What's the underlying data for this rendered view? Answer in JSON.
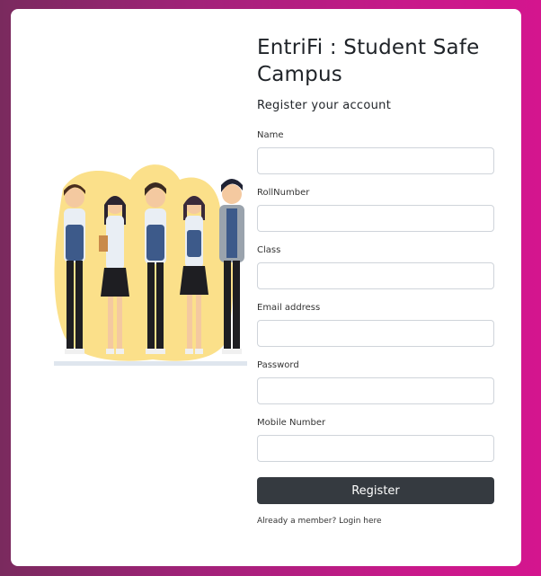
{
  "app": {
    "title": "EntriFi : Student Safe Campus",
    "subtitle": "Register your account"
  },
  "form": {
    "fields": [
      {
        "label": "Name",
        "value": ""
      },
      {
        "label": "RollNumber",
        "value": ""
      },
      {
        "label": "Class",
        "value": ""
      },
      {
        "label": "Email address",
        "value": ""
      },
      {
        "label": "Password",
        "value": ""
      },
      {
        "label": "Mobile Number",
        "value": ""
      }
    ],
    "submit_label": "Register",
    "login_text": "Already a member? Login here"
  },
  "colors": {
    "button": "#353a40",
    "background_start": "#7a2a5e",
    "background_end": "#d4158e",
    "illustration_blob": "#fbe08a"
  }
}
